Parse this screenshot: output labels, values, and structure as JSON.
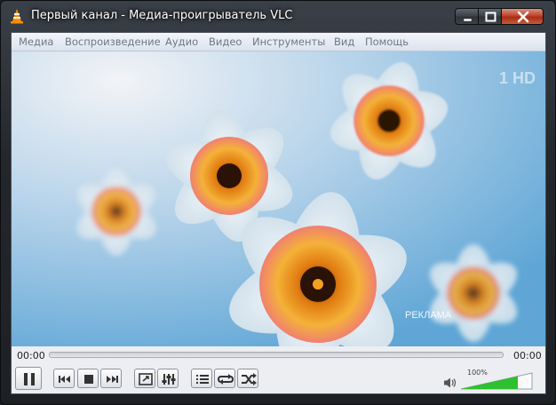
{
  "window": {
    "title": "Первый канал - Медиа-проигрыватель VLC"
  },
  "menu": {
    "items": [
      "Медиа",
      "Воспроизведение",
      "Аудио",
      "Видео",
      "Инструменты",
      "Вид",
      "Помощь"
    ]
  },
  "video": {
    "channel_logo": "1 HD",
    "overlay_text": "РЕКЛАМА"
  },
  "playback": {
    "elapsed": "00:00",
    "total": "00:00",
    "progress": 0
  },
  "controls": {
    "buttons": [
      "pause-icon",
      "previous-icon",
      "stop-icon",
      "next-icon",
      "fullscreen-icon",
      "extended-settings-icon",
      "playlist-icon",
      "loop-icon",
      "shuffle-icon"
    ]
  },
  "volume": {
    "label": "100%",
    "level": 1.0,
    "color": "#2ec02e"
  },
  "colors": {
    "accent": "#ff8800",
    "close": "#c0442d"
  }
}
